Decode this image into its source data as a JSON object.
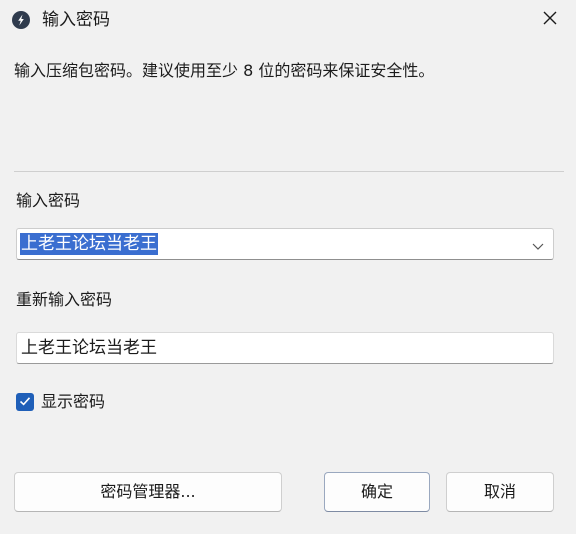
{
  "window": {
    "title": "输入密码",
    "app_icon": "lightning-icon",
    "close_icon": "close-icon"
  },
  "description": "输入压缩包密码。建议使用至少 8 位的密码来保证安全性。",
  "password": {
    "label": "输入密码",
    "value": "上老王论坛当老王",
    "dropdown_icon": "chevron-down-icon"
  },
  "confirm_password": {
    "label": "重新输入密码",
    "value": "上老王论坛当老王"
  },
  "show_password": {
    "label": "显示密码",
    "checked": true
  },
  "buttons": {
    "manager": "密码管理器...",
    "ok": "确定",
    "cancel": "取消"
  },
  "colors": {
    "accent": "#1f5fb8",
    "selection": "#3a6ed0"
  }
}
